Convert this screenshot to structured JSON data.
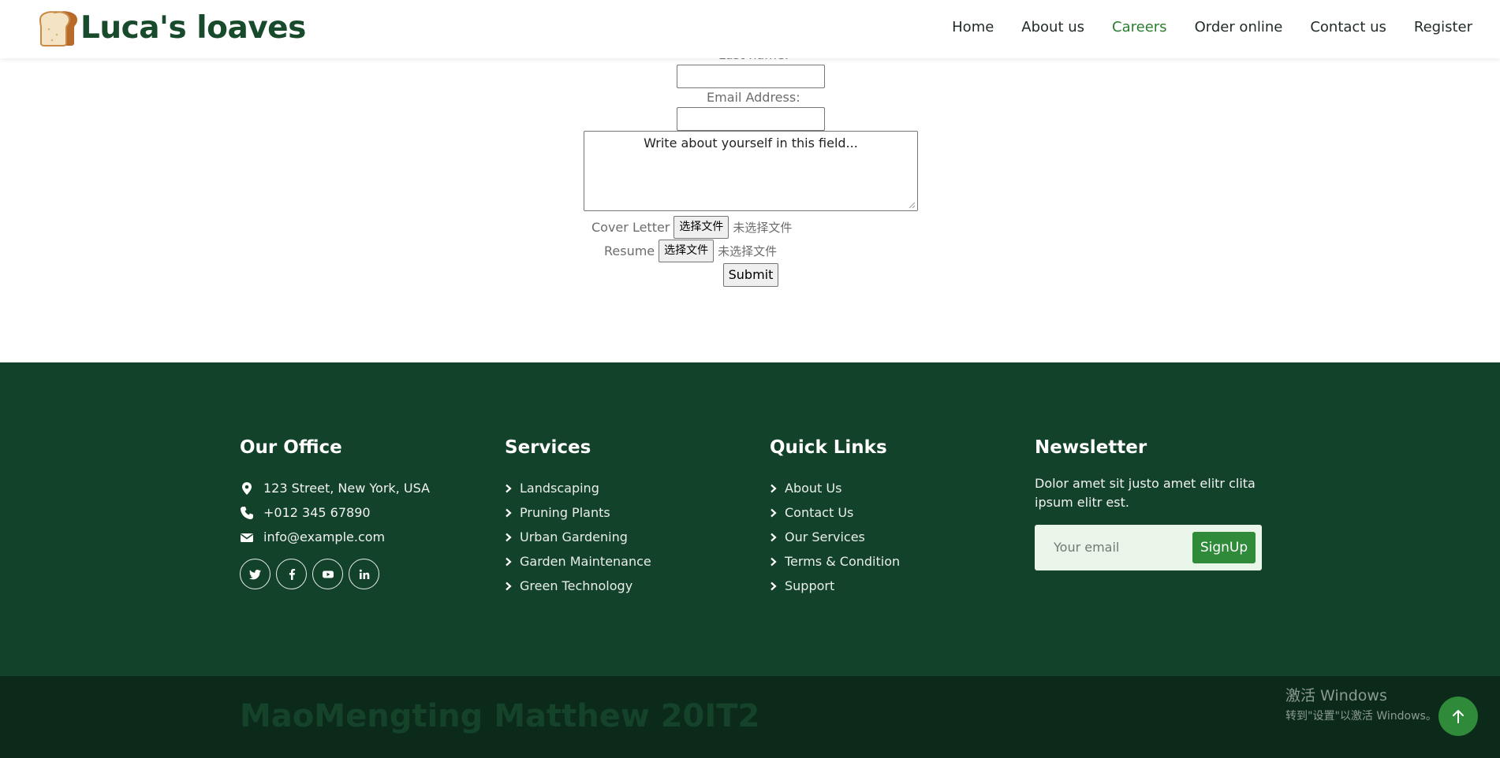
{
  "header": {
    "logo_text": "Luca's loaves",
    "nav": [
      {
        "label": "Home"
      },
      {
        "label": "About us"
      },
      {
        "label": "Careers",
        "active": true
      },
      {
        "label": "Order online"
      },
      {
        "label": "Contact us"
      },
      {
        "label": "Register"
      }
    ]
  },
  "form": {
    "last_name_label": "Last name:",
    "email_label": "Email Address:",
    "textarea_placeholder": "Write about yourself in this field...",
    "cover_letter_label": "Cover Letter",
    "resume_label": "Resume",
    "choose_file_label": "选择文件",
    "no_file_label": "未选择文件",
    "submit_label": "Submit"
  },
  "footer": {
    "office": {
      "title": "Our Office",
      "address": "123 Street, New York, USA",
      "phone": "+012 345 67890",
      "email": "info@example.com",
      "socials": [
        "twitter-icon",
        "facebook-icon",
        "youtube-icon",
        "linkedin-icon"
      ]
    },
    "services": {
      "title": "Services",
      "items": [
        "Landscaping",
        "Pruning Plants",
        "Urban Gardening",
        "Garden Maintenance",
        "Green Technology"
      ]
    },
    "quick_links": {
      "title": "Quick Links",
      "items": [
        "About Us",
        "Contact Us",
        "Our Services",
        "Terms & Condition",
        "Support"
      ]
    },
    "newsletter": {
      "title": "Newsletter",
      "text": "Dolor amet sit justo amet elitr clita ipsum elitr est.",
      "placeholder": "Your email",
      "button": "SignUp"
    }
  },
  "bottom": {
    "credit": "MaoMengting Matthew 20IT2",
    "watermark_title": "激活 Windows",
    "watermark_sub": "转到\"设置\"以激活 Windows。"
  },
  "colors": {
    "footer_bg": "#13422b",
    "bottom_bg": "#0b2a1a",
    "accent": "#2f8a3a",
    "nav_active": "#2a7d2f",
    "logo_text": "#184a2c"
  }
}
